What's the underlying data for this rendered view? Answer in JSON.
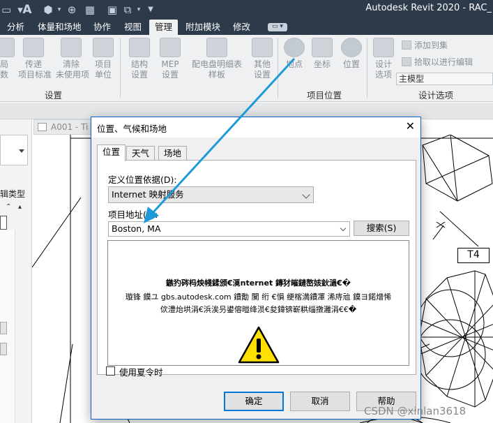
{
  "app": {
    "title": "Autodesk Revit 2020 - RAC_"
  },
  "quick_access": {
    "icons": [
      "open-icon",
      "save-icon",
      "text-A-icon",
      "3d-view-icon",
      "grid-icon",
      "window-icon",
      "dropdown-icon"
    ]
  },
  "ribbon_tabs": [
    "分析",
    "体量和场地",
    "协作",
    "视图",
    "管理",
    "附加模块",
    "修改"
  ],
  "active_tab": "管理",
  "ribbon": {
    "settings_group": {
      "label": "设置",
      "buttons": [
        {
          "line1": "局",
          "line2": "数"
        },
        {
          "line1": "传递",
          "line2": "项目标准"
        },
        {
          "line1": "清除",
          "line2": "未使用项"
        },
        {
          "line1": "项目",
          "line2": "单位"
        },
        {
          "line1": "结构",
          "line2": "设置"
        },
        {
          "line1": "MEP",
          "line2": "设置"
        },
        {
          "line1": "配电盘明细表",
          "line2": "样板"
        },
        {
          "line1": "其他",
          "line2": "设置"
        }
      ]
    },
    "location_group": {
      "label": "项目位置",
      "buttons": [
        {
          "line1": "地点"
        },
        {
          "line1": "坐标"
        },
        {
          "line1": "位置"
        }
      ]
    },
    "design_options_group": {
      "label": "设计选项",
      "button": {
        "line1": "设计",
        "line2": "选项"
      },
      "add_to_set": "添加到集",
      "pick_to_edit": "拾取以进行编辑",
      "main_model": "主模型"
    }
  },
  "workspace": {
    "view_tab": "A001 - Ti",
    "properties_type_label": "辑类型",
    "tag": "T4"
  },
  "dialog": {
    "title": "位置、气候和场地",
    "close": "✕",
    "tabs": [
      "位置",
      "天气",
      "场地"
    ],
    "active_tab": "位置",
    "define_by_label": "定义位置依据(D):",
    "define_by_value": "Internet 映射服务",
    "project_address_label": "项目地址(P):",
    "project_address_value": "Boston, MA",
    "search_button": "搜索(S)",
    "map_message_line1": "鏃犳硶杩炴帴鍒颁€漞nternet 鏄犲皠鏈嶅姟鈥濄€�",
    "map_message_line2": "璇锋   鏌ユ   gbs.autodesk.com 鐨勪    闃     绗   €愪   绠楁満鐨凙    浠庤兘   鏌ヨ鍩熷悕",
    "map_message_line3": "佽澧炲垬涓€浜涘叧鍙傛暟绛涢€夋鍏锛嶄粠缁撴灉涓€€�",
    "daylight_saving_label": "使用夏令时",
    "ok_button": "确定",
    "cancel_button": "取消",
    "help_button": "帮助"
  },
  "watermark": "CSDN @xinlan3618",
  "colors": {
    "title_bar": "#2d3a4a",
    "ribbon_bg": "#eef0f2",
    "dialog_border": "#0b61c2",
    "annotation_arrow": "#1e9ad8",
    "warning_yellow": "#ffe000"
  }
}
